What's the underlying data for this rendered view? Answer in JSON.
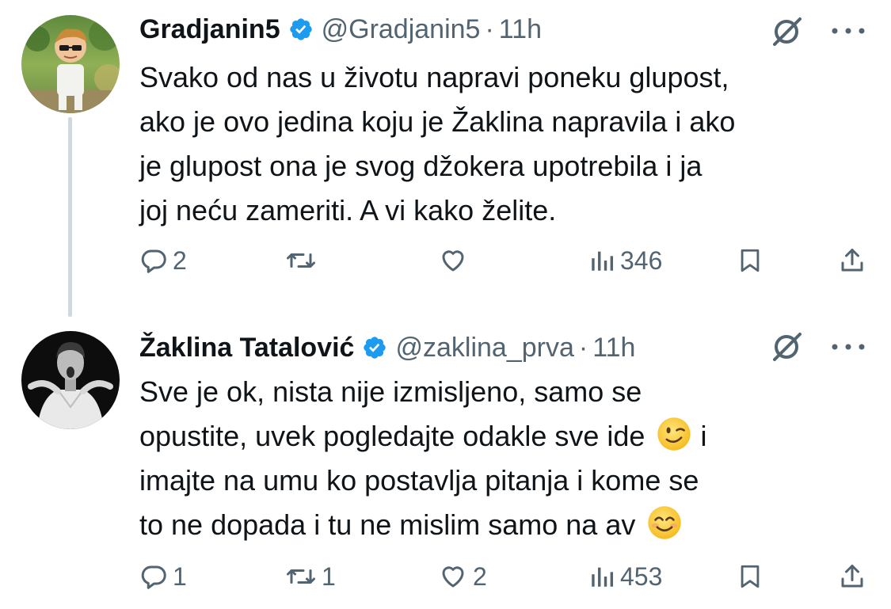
{
  "tweets": [
    {
      "author": {
        "display_name": "Gradjanin5",
        "handle": "@Gradjanin5",
        "verified": true
      },
      "time": "11h",
      "text_lines": [
        "Svako od nas u životu napravi poneku glupost,",
        "ako je ovo jedina koju je Žaklina napravila i ako",
        "je glupost ona je svog džokera upotrebila i ja",
        "joj neću zameriti. A vi kako želite."
      ],
      "stats": {
        "replies": "2",
        "reposts": "",
        "likes": "",
        "views": "346"
      }
    },
    {
      "author": {
        "display_name": "Žaklina Tatalović",
        "handle": "@zaklina_prva",
        "verified": true
      },
      "time": "11h",
      "text_lines": [
        "Sve je ok, nista nije izmisljeno, samo se",
        "opustite, uvek pogledajte odakle sve ide",
        "i",
        "imajte na umu ko postavlja pitanja i kome se",
        "to ne dopada i tu ne mislim samo na av"
      ],
      "emojis": [
        "winking-face",
        "smiling-face-with-smiling-eyes"
      ],
      "stats": {
        "replies": "1",
        "reposts": "1",
        "likes": "2",
        "views": "453"
      }
    }
  ],
  "separator": "·",
  "icons": [
    "verified-badge-icon",
    "grok-icon",
    "more-icon",
    "reply-icon",
    "repost-icon",
    "like-icon",
    "views-icon",
    "bookmark-icon",
    "share-icon"
  ],
  "colors": {
    "text": "#0f1419",
    "secondary": "#536471",
    "verified": "#1d9bf0",
    "thread_line": "#cfd9de"
  }
}
